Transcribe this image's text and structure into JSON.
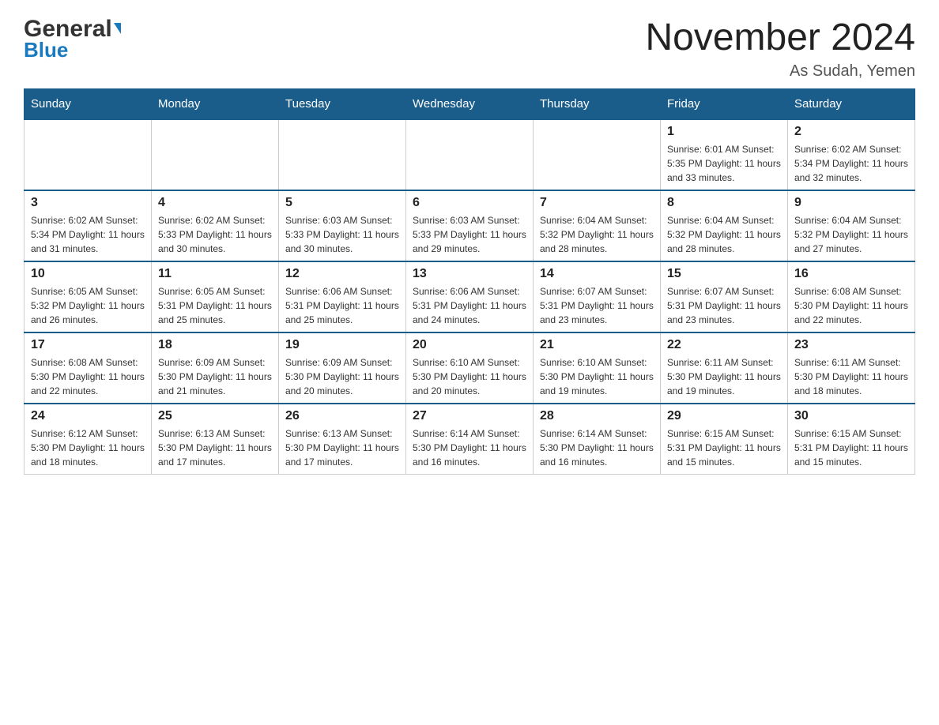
{
  "header": {
    "logo_general": "General",
    "logo_blue": "Blue",
    "title": "November 2024",
    "location": "As Sudah, Yemen"
  },
  "calendar": {
    "days_of_week": [
      "Sunday",
      "Monday",
      "Tuesday",
      "Wednesday",
      "Thursday",
      "Friday",
      "Saturday"
    ],
    "weeks": [
      [
        {
          "day": "",
          "info": ""
        },
        {
          "day": "",
          "info": ""
        },
        {
          "day": "",
          "info": ""
        },
        {
          "day": "",
          "info": ""
        },
        {
          "day": "",
          "info": ""
        },
        {
          "day": "1",
          "info": "Sunrise: 6:01 AM\nSunset: 5:35 PM\nDaylight: 11 hours and 33 minutes."
        },
        {
          "day": "2",
          "info": "Sunrise: 6:02 AM\nSunset: 5:34 PM\nDaylight: 11 hours and 32 minutes."
        }
      ],
      [
        {
          "day": "3",
          "info": "Sunrise: 6:02 AM\nSunset: 5:34 PM\nDaylight: 11 hours and 31 minutes."
        },
        {
          "day": "4",
          "info": "Sunrise: 6:02 AM\nSunset: 5:33 PM\nDaylight: 11 hours and 30 minutes."
        },
        {
          "day": "5",
          "info": "Sunrise: 6:03 AM\nSunset: 5:33 PM\nDaylight: 11 hours and 30 minutes."
        },
        {
          "day": "6",
          "info": "Sunrise: 6:03 AM\nSunset: 5:33 PM\nDaylight: 11 hours and 29 minutes."
        },
        {
          "day": "7",
          "info": "Sunrise: 6:04 AM\nSunset: 5:32 PM\nDaylight: 11 hours and 28 minutes."
        },
        {
          "day": "8",
          "info": "Sunrise: 6:04 AM\nSunset: 5:32 PM\nDaylight: 11 hours and 28 minutes."
        },
        {
          "day": "9",
          "info": "Sunrise: 6:04 AM\nSunset: 5:32 PM\nDaylight: 11 hours and 27 minutes."
        }
      ],
      [
        {
          "day": "10",
          "info": "Sunrise: 6:05 AM\nSunset: 5:32 PM\nDaylight: 11 hours and 26 minutes."
        },
        {
          "day": "11",
          "info": "Sunrise: 6:05 AM\nSunset: 5:31 PM\nDaylight: 11 hours and 25 minutes."
        },
        {
          "day": "12",
          "info": "Sunrise: 6:06 AM\nSunset: 5:31 PM\nDaylight: 11 hours and 25 minutes."
        },
        {
          "day": "13",
          "info": "Sunrise: 6:06 AM\nSunset: 5:31 PM\nDaylight: 11 hours and 24 minutes."
        },
        {
          "day": "14",
          "info": "Sunrise: 6:07 AM\nSunset: 5:31 PM\nDaylight: 11 hours and 23 minutes."
        },
        {
          "day": "15",
          "info": "Sunrise: 6:07 AM\nSunset: 5:31 PM\nDaylight: 11 hours and 23 minutes."
        },
        {
          "day": "16",
          "info": "Sunrise: 6:08 AM\nSunset: 5:30 PM\nDaylight: 11 hours and 22 minutes."
        }
      ],
      [
        {
          "day": "17",
          "info": "Sunrise: 6:08 AM\nSunset: 5:30 PM\nDaylight: 11 hours and 22 minutes."
        },
        {
          "day": "18",
          "info": "Sunrise: 6:09 AM\nSunset: 5:30 PM\nDaylight: 11 hours and 21 minutes."
        },
        {
          "day": "19",
          "info": "Sunrise: 6:09 AM\nSunset: 5:30 PM\nDaylight: 11 hours and 20 minutes."
        },
        {
          "day": "20",
          "info": "Sunrise: 6:10 AM\nSunset: 5:30 PM\nDaylight: 11 hours and 20 minutes."
        },
        {
          "day": "21",
          "info": "Sunrise: 6:10 AM\nSunset: 5:30 PM\nDaylight: 11 hours and 19 minutes."
        },
        {
          "day": "22",
          "info": "Sunrise: 6:11 AM\nSunset: 5:30 PM\nDaylight: 11 hours and 19 minutes."
        },
        {
          "day": "23",
          "info": "Sunrise: 6:11 AM\nSunset: 5:30 PM\nDaylight: 11 hours and 18 minutes."
        }
      ],
      [
        {
          "day": "24",
          "info": "Sunrise: 6:12 AM\nSunset: 5:30 PM\nDaylight: 11 hours and 18 minutes."
        },
        {
          "day": "25",
          "info": "Sunrise: 6:13 AM\nSunset: 5:30 PM\nDaylight: 11 hours and 17 minutes."
        },
        {
          "day": "26",
          "info": "Sunrise: 6:13 AM\nSunset: 5:30 PM\nDaylight: 11 hours and 17 minutes."
        },
        {
          "day": "27",
          "info": "Sunrise: 6:14 AM\nSunset: 5:30 PM\nDaylight: 11 hours and 16 minutes."
        },
        {
          "day": "28",
          "info": "Sunrise: 6:14 AM\nSunset: 5:30 PM\nDaylight: 11 hours and 16 minutes."
        },
        {
          "day": "29",
          "info": "Sunrise: 6:15 AM\nSunset: 5:31 PM\nDaylight: 11 hours and 15 minutes."
        },
        {
          "day": "30",
          "info": "Sunrise: 6:15 AM\nSunset: 5:31 PM\nDaylight: 11 hours and 15 minutes."
        }
      ]
    ]
  }
}
